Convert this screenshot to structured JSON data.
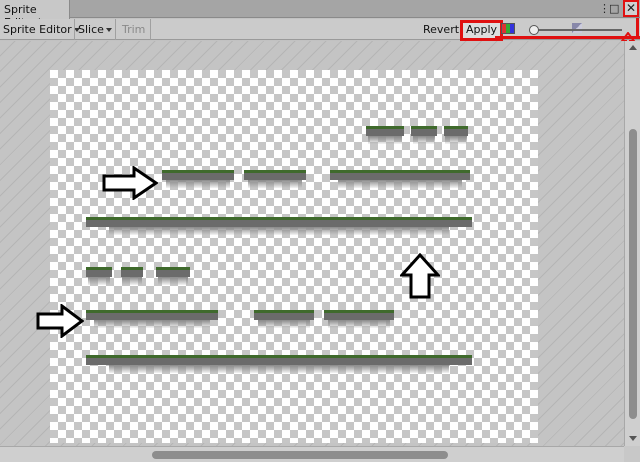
{
  "window": {
    "tab_title": "Sprite Editor*",
    "more_icon": "⋮",
    "maximize_icon": "□",
    "close_icon": "✕"
  },
  "toolbar": {
    "mode_label": "Sprite Editor",
    "slice_label": "Slice",
    "trim_label": "Trim",
    "revert_label": "Revert",
    "apply_label": "Apply"
  },
  "colors": {
    "highlight": "#e01010",
    "grass": "#3f6a2c",
    "rock": "#6b6b6b"
  }
}
